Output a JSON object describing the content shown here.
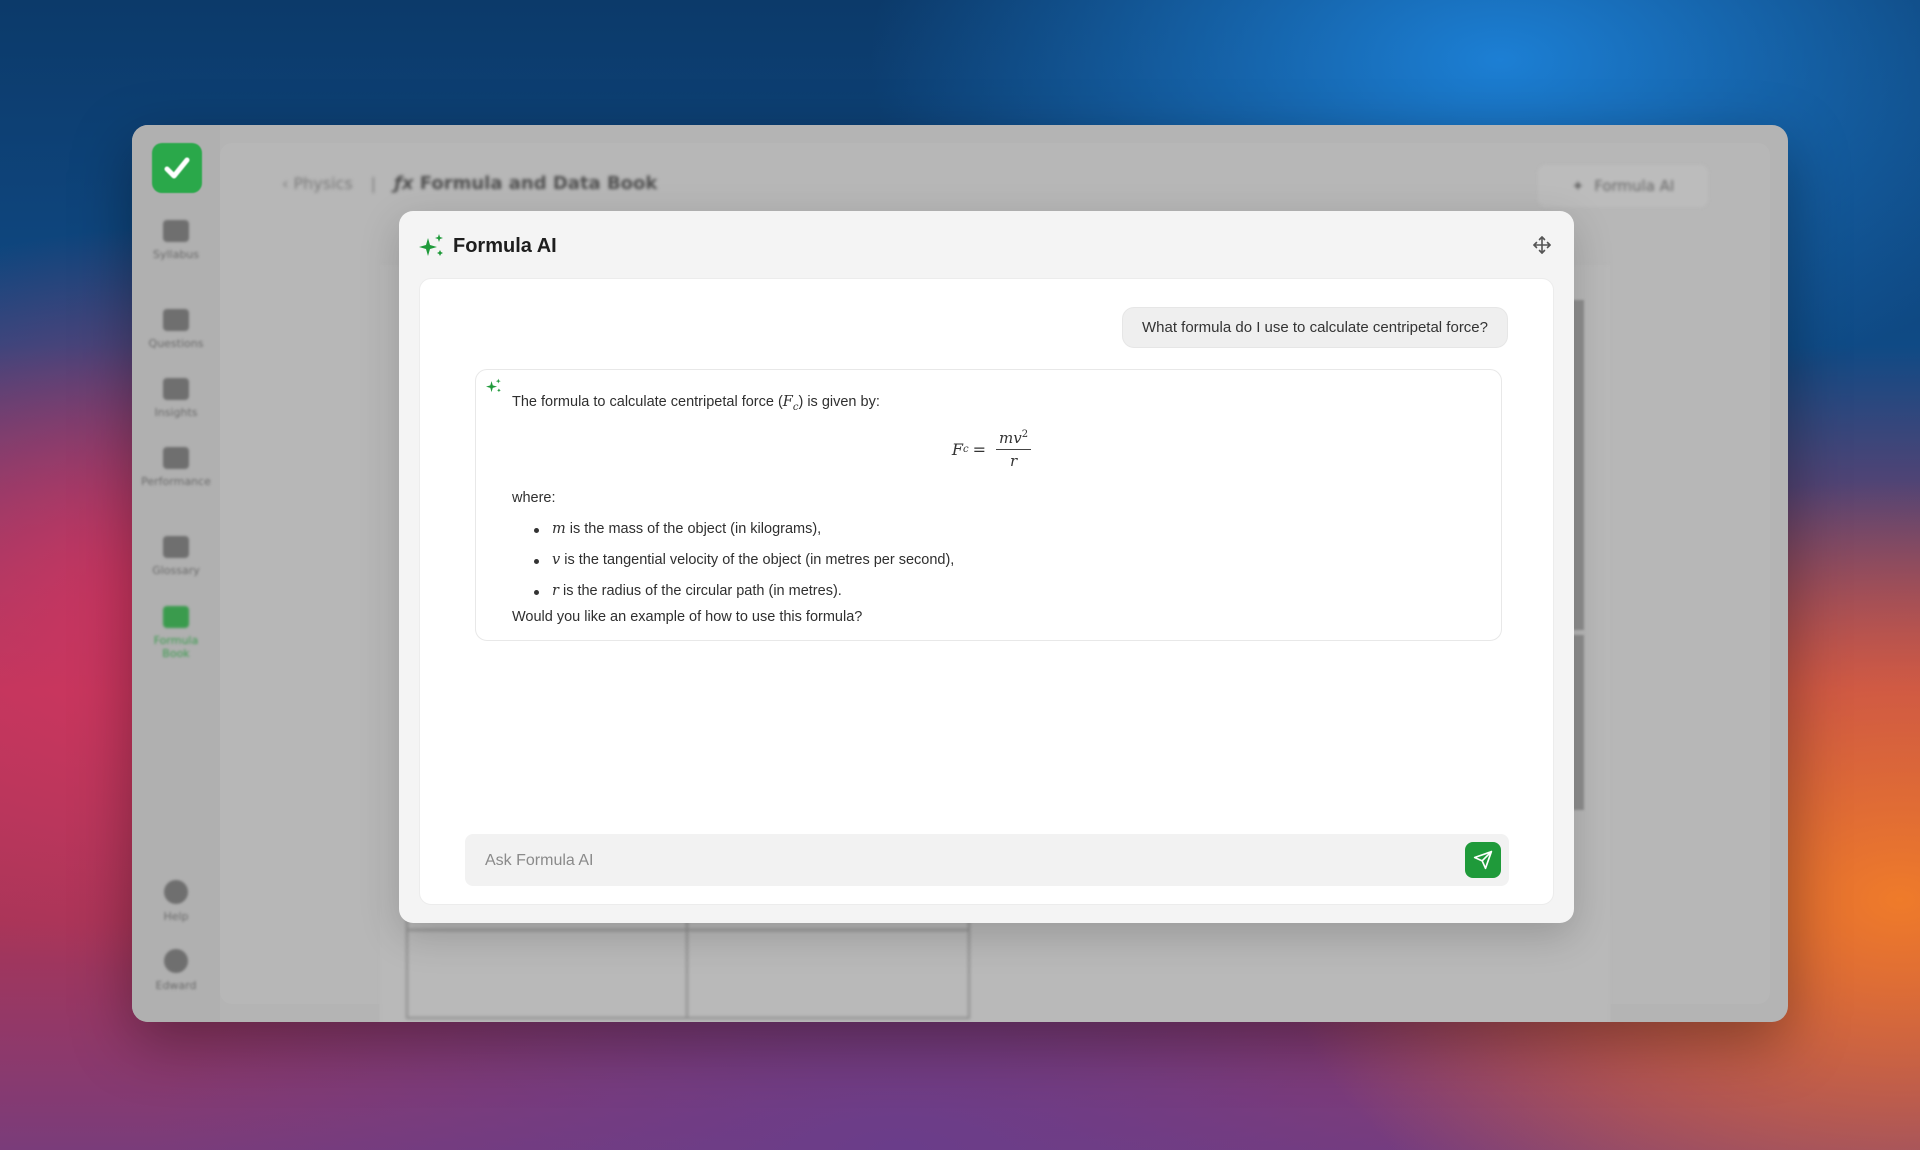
{
  "app": {
    "sidebar": {
      "items": [
        {
          "label": "Syllabus",
          "icon": "book-icon"
        },
        {
          "label": "Questions",
          "icon": "questions-icon"
        },
        {
          "label": "Insights",
          "icon": "bar-chart-icon"
        },
        {
          "label": "Performance",
          "icon": "trophy-icon"
        },
        {
          "label": "Glossary",
          "icon": "glossary-icon"
        },
        {
          "label": "Formula Book",
          "icon": "fx-icon",
          "active": true
        },
        {
          "label": "Help",
          "icon": "help-icon"
        },
        {
          "label": "Edward",
          "icon": "user-icon"
        }
      ]
    },
    "breadcrumb": {
      "back": "Physics",
      "title": "Formula and Data Book"
    },
    "header_button": "Formula AI",
    "accent_color": "#1f9a3a"
  },
  "modal": {
    "title": "Formula AI",
    "user_message": "What formula do I use to calculate centripetal force?",
    "ai_message": {
      "intro_before": "The formula to calculate centripetal force (",
      "intro_symbol": "F",
      "intro_sub": "c",
      "intro_after": ") is given by:",
      "formula": {
        "lhs": "F",
        "lhs_sub": "c",
        "eq": "=",
        "numerator": "mv",
        "numerator_sup": "2",
        "denominator": "r"
      },
      "where": "where:",
      "bullets": [
        {
          "symbol": "m",
          "text": " is the mass of the object (in kilograms),"
        },
        {
          "symbol": "v",
          "text": " is the tangential velocity of the object (in metres per second),"
        },
        {
          "symbol": "r",
          "text": " is the radius of the circular path (in metres)."
        }
      ],
      "closing": "Would you like an example of how to use this formula?"
    },
    "input_placeholder": "Ask Formula AI"
  }
}
